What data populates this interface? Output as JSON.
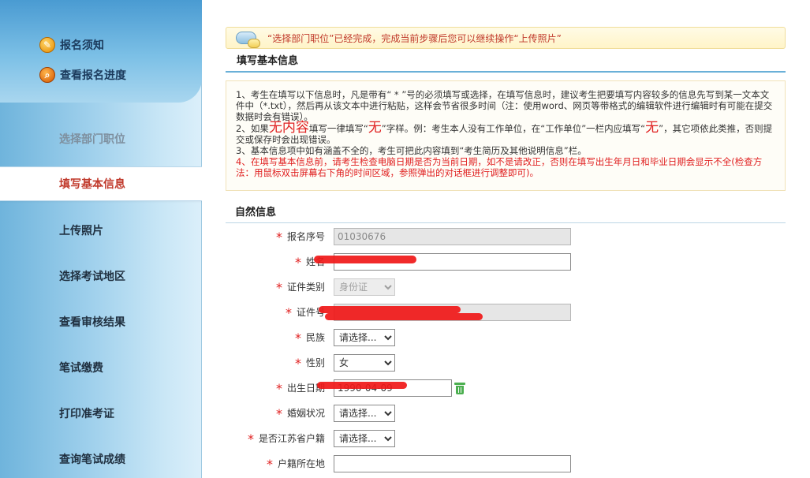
{
  "sidebar": {
    "top_links": [
      {
        "label": "报名须知",
        "icon": "pencil-icon"
      },
      {
        "label": "查看报名进度",
        "icon": "search-icon"
      }
    ],
    "items": [
      {
        "label": "选择部门职位",
        "state": "done"
      },
      {
        "label": "填写基本信息",
        "state": "active"
      },
      {
        "label": "上传照片",
        "state": "normal"
      },
      {
        "label": "选择考试地区",
        "state": "normal"
      },
      {
        "label": "查看审核结果",
        "state": "normal"
      },
      {
        "label": "笔试缴费",
        "state": "normal"
      },
      {
        "label": "打印准考证",
        "state": "normal"
      },
      {
        "label": "查询笔试成绩",
        "state": "normal"
      }
    ]
  },
  "notice": {
    "icon": "chat-bubble-icon",
    "text": "“选择部门职位”已经完成，完成当前步骤后您可以继续操作“上传照片”"
  },
  "section_title": "填写基本信息",
  "instructions": {
    "p1": "1、考生在填写以下信息时，凡是带有“ * ”号的必须填写或选择，在填写信息时，建议考生把要填写内容较多的信息先写到某一文本文件中（*.txt），然后再从该文本中进行粘贴，这样会节省很多时间（注：使用word、网页等带格式的编辑软件进行编辑时有可能在提交数据时会有错误）。",
    "p2_a": "2、如果",
    "p2_big1": "无内容",
    "p2_b": "填写一律填写“",
    "p2_big2": "无",
    "p2_c": "”字样。例：考生本人没有工作单位，在“工作单位”一栏内应填写“",
    "p2_big3": "无",
    "p2_d": "”，其它项依此类推，否则提交或保存时会出现错误。",
    "p3": "3、基本信息项中如有涵盖不全的，考生可把此内容填到“考生简历及其他说明信息”栏。",
    "p4": "4、在填写基本信息前，请考生检查电脑日期是否为当前日期，如不是请改正，否则在填写出生年月日和毕业日期会显示不全(检查方法：用鼠标双击屏幕右下角的时间区域，参照弹出的对话框进行调整即可)。"
  },
  "sub_title": "自然信息",
  "form": {
    "star": "*",
    "reg_no": {
      "label": "报名序号",
      "value": "01030676"
    },
    "name": {
      "label": "姓名",
      "value": ""
    },
    "id_type": {
      "label": "证件类别",
      "value": "身份证"
    },
    "id_no": {
      "label": "证件号",
      "value": ""
    },
    "ethnicity": {
      "label": "民族",
      "value": "请选择..."
    },
    "gender": {
      "label": "性别",
      "value": "女"
    },
    "birth": {
      "label": "出生日期",
      "value": "1990-04-09"
    },
    "marital": {
      "label": "婚姻状况",
      "value": "请选择..."
    },
    "jiangsu": {
      "label": "是否江苏省户籍",
      "value": "请选择..."
    },
    "hukou": {
      "label": "户籍所在地",
      "value": ""
    }
  },
  "colors": {
    "accent_red": "#e02020",
    "nav_blue": "#6fb4dc",
    "notice_bg": "#fff4c8"
  }
}
